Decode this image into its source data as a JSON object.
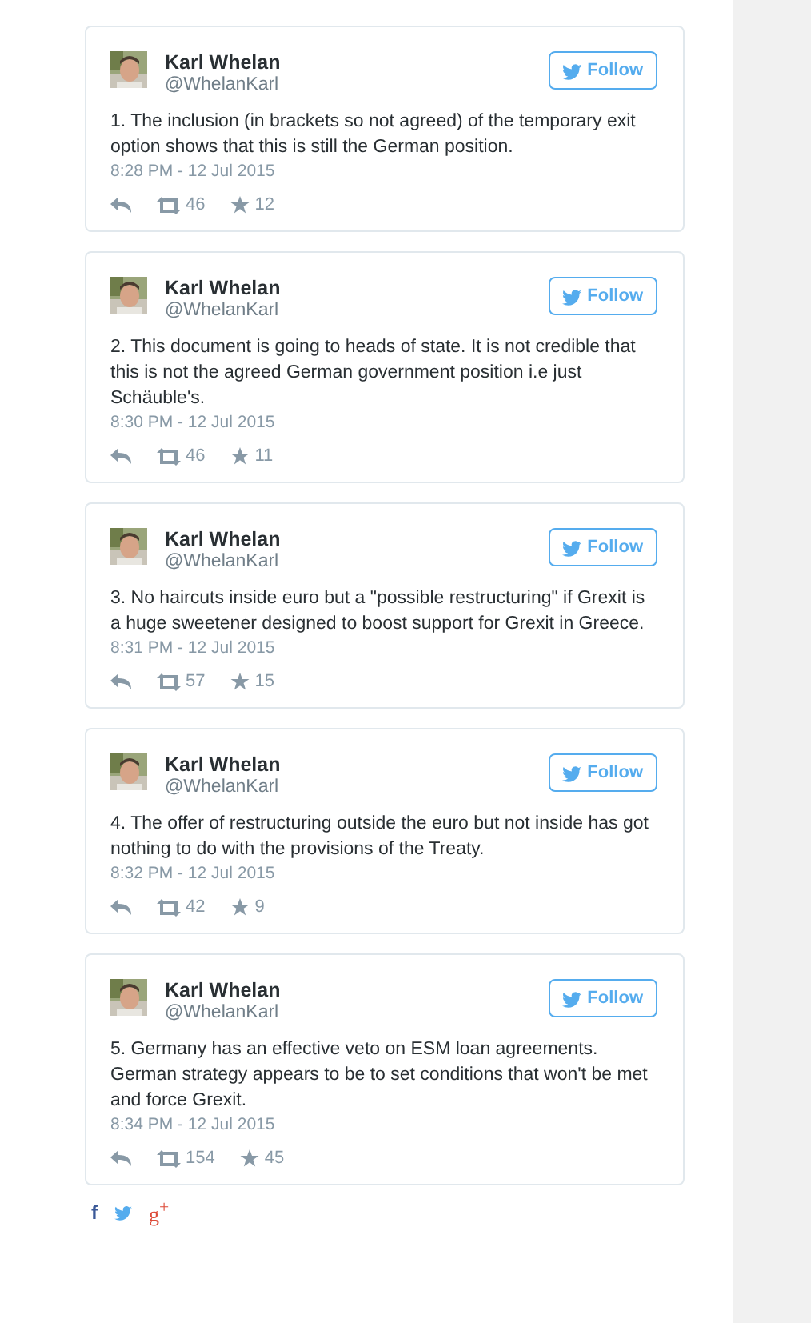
{
  "tweets": [
    {
      "name": "Karl Whelan",
      "handle": "@WhelanKarl",
      "follow": "Follow",
      "text": "1. The inclusion (in brackets so not agreed) of the temporary exit option shows that this is still the German position.",
      "time": "8:28 PM - 12 Jul 2015",
      "retweets": "46",
      "favorites": "12"
    },
    {
      "name": "Karl Whelan",
      "handle": "@WhelanKarl",
      "follow": "Follow",
      "text": "2. This document is going to heads of state. It is not credible that this is not the agreed German government position i.e just Schäuble's.",
      "time": "8:30 PM - 12 Jul 2015",
      "retweets": "46",
      "favorites": "11"
    },
    {
      "name": "Karl Whelan",
      "handle": "@WhelanKarl",
      "follow": "Follow",
      "text": "3. No haircuts inside euro but a \"possible restructuring\" if Grexit is a huge sweetener designed to boost support for Grexit in Greece.",
      "time": "8:31 PM - 12 Jul 2015",
      "retweets": "57",
      "favorites": "15"
    },
    {
      "name": "Karl Whelan",
      "handle": "@WhelanKarl",
      "follow": "Follow",
      "text": "4. The offer of restructuring outside the euro but not inside has got nothing to do with the provisions of the Treaty.",
      "time": "8:32 PM - 12 Jul 2015",
      "retweets": "42",
      "favorites": "9"
    },
    {
      "name": "Karl Whelan",
      "handle": "@WhelanKarl",
      "follow": "Follow",
      "text": "5. Germany has an effective veto on ESM loan agreements. German strategy appears to be to set conditions that won't be met and force Grexit.",
      "time": "8:34 PM - 12 Jul 2015",
      "retweets": "154",
      "favorites": "45"
    }
  ],
  "share": [
    {
      "kind": "facebook",
      "label": "f"
    },
    {
      "kind": "twitter"
    },
    {
      "kind": "google",
      "label": "g$^{+}$"
    }
  ]
}
